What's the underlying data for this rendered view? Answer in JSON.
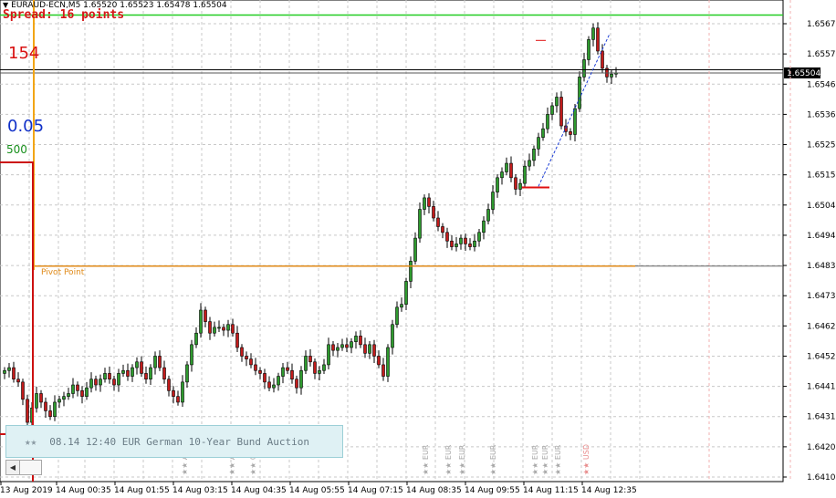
{
  "header": {
    "symbol_info": "EURAUD-ECN,M5  1.65520 1.65523 1.65478 1.65504",
    "spread_text": "Spread: 16 points",
    "pips_value": "154",
    "lot_value": "0.05",
    "points_value": "500"
  },
  "pivot": {
    "label": "Pivot Point",
    "price": 1.64833,
    "color": "#e08a18"
  },
  "news": {
    "stars": "★★",
    "text": "08.14 12:40 EUR German 10-Year Bund Auction"
  },
  "chart_data": {
    "type": "candlestick",
    "symbol": "EURAUD-ECN",
    "timeframe": "M5",
    "ohlc_header": {
      "open": 1.6552,
      "high": 1.65523,
      "low": 1.65478,
      "close": 1.65504
    },
    "current_price": 1.65504,
    "ylim": [
      1.641,
      1.6572
    ],
    "y_ticks": [
      "1.65675",
      "1.65570",
      "1.65465",
      "1.65360",
      "1.65255",
      "1.65150",
      "1.65045",
      "1.64940",
      "1.64835",
      "1.64730",
      "1.64625",
      "1.64520",
      "1.64415",
      "1.64310",
      "1.64205",
      "1.64100"
    ],
    "x_ticks": [
      "13 Aug 2019",
      "14 Aug 00:35",
      "14 Aug 01:55",
      "14 Aug 03:15",
      "14 Aug 04:35",
      "14 Aug 05:55",
      "14 Aug 07:15",
      "14 Aug 08:35",
      "14 Aug 09:55",
      "14 Aug 11:15",
      "14 Aug 12:35"
    ],
    "grid": true,
    "bull_color": "#2e9a2e",
    "bear_color": "#c21b1b",
    "levels": {
      "green_line": 1.65705,
      "black_line": 1.65515,
      "red_marker": 1.65106,
      "red_short_tick": 1.65617
    },
    "news_flag_labels": [
      "AUD",
      "AUD",
      "CNY",
      "EUR",
      "EUR",
      "EUR",
      "EUR",
      "EUR",
      "EUR",
      "EUR",
      "USD"
    ],
    "closes": [
      1.6447,
      1.6448,
      1.6444,
      1.6443,
      1.6437,
      1.6429,
      1.6434,
      1.6439,
      1.6436,
      1.6433,
      1.6431,
      1.6436,
      1.6437,
      1.6438,
      1.6439,
      1.6442,
      1.644,
      1.6438,
      1.6441,
      1.6444,
      1.6442,
      1.6444,
      1.6446,
      1.6444,
      1.6442,
      1.6446,
      1.6447,
      1.6445,
      1.6448,
      1.645,
      1.6446,
      1.6444,
      1.6448,
      1.6452,
      1.6448,
      1.6444,
      1.644,
      1.6438,
      1.6436,
      1.6443,
      1.6449,
      1.6456,
      1.646,
      1.6468,
      1.6464,
      1.646,
      1.6462,
      1.6462,
      1.6461,
      1.6463,
      1.646,
      1.6455,
      1.6452,
      1.6451,
      1.6449,
      1.6447,
      1.6446,
      1.6443,
      1.6441,
      1.6442,
      1.6445,
      1.6448,
      1.6447,
      1.6444,
      1.6441,
      1.6447,
      1.6452,
      1.645,
      1.6446,
      1.6447,
      1.6449,
      1.6456,
      1.6454,
      1.6455,
      1.6456,
      1.6455,
      1.6457,
      1.6459,
      1.6456,
      1.6453,
      1.6456,
      1.6452,
      1.6449,
      1.6445,
      1.6455,
      1.6463,
      1.6469,
      1.647,
      1.6478,
      1.6485,
      1.6493,
      1.6503,
      1.6507,
      1.6504,
      1.65,
      1.6497,
      1.6495,
      1.6492,
      1.649,
      1.6491,
      1.6493,
      1.6491,
      1.649,
      1.6492,
      1.6495,
      1.6499,
      1.6503,
      1.6509,
      1.6514,
      1.6516,
      1.6519,
      1.6514,
      1.651,
      1.6512,
      1.6518,
      1.652,
      1.6524,
      1.6528,
      1.6531,
      1.6536,
      1.6539,
      1.6542,
      1.6532,
      1.653,
      1.6529,
      1.6538,
      1.6549,
      1.6555,
      1.6562,
      1.6566,
      1.6558,
      1.6552,
      1.6549,
      1.655,
      1.65504
    ]
  }
}
